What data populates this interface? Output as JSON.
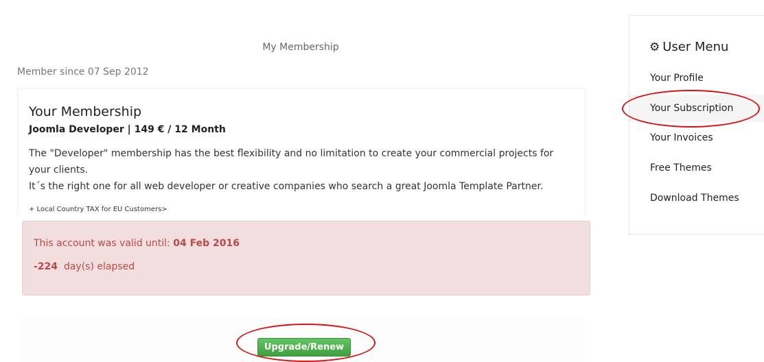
{
  "main": {
    "page_heading": "My Membership",
    "member_since": "Member since 07 Sep 2012",
    "card": {
      "title": "Your Membership",
      "plan": "Joomla Developer | 149 € / 12 Month",
      "description_1": "The \"Developer\" membership has the best flexibility and no limitation to create your commercial projects for your clients.",
      "description_2": "It´s the right one for all web developer or creative companies who search a great Joomla Template Partner.",
      "tax_note": "+ Local Country TAX for EU Customers>"
    },
    "alert": {
      "valid_label": "This account was valid until:",
      "valid_date": "04 Feb 2016",
      "elapsed_days": "-224",
      "elapsed_label": "day(s) elapsed",
      "color": "#b94a48"
    },
    "upgrade_button_label": "Upgrade/Renew"
  },
  "sidebar": {
    "title": "User Menu",
    "icon": "gear-icon",
    "items": [
      {
        "label": "Your Profile"
      },
      {
        "label": "Your Subscription",
        "active": true
      },
      {
        "label": "Your Invoices"
      },
      {
        "label": "Free Themes"
      },
      {
        "label": "Download Themes"
      }
    ]
  },
  "annotations": {
    "highlight_color": "#dd1111"
  }
}
